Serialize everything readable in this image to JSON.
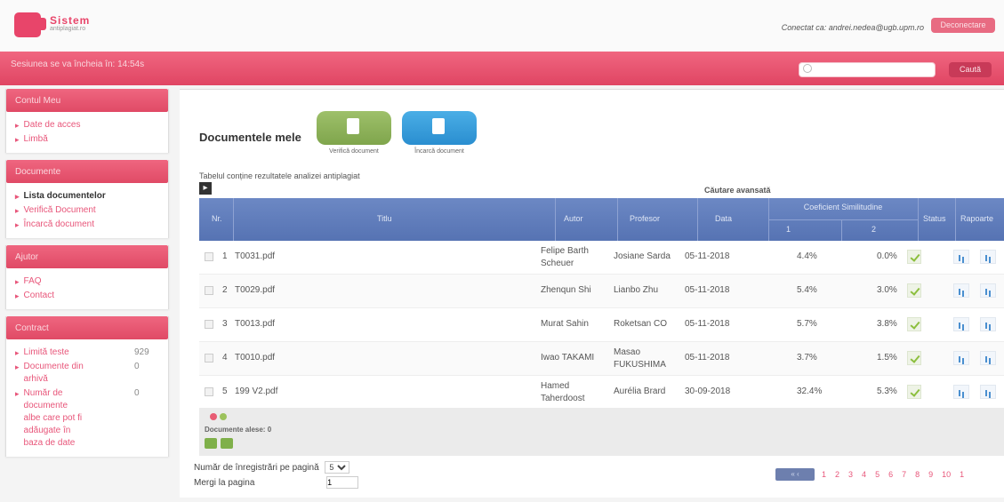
{
  "header": {
    "logo_line1": "Sistem",
    "logo_line2": "antiplagiat.ro",
    "connected_text": "Conectat ca: andrei.nedea@ugb.upm.ro",
    "logout_label": "Deconectare"
  },
  "sessionbar": {
    "session_text": "Sesiunea se va încheia în: 14:54s",
    "search_placeholder": "",
    "search_button": "Caută"
  },
  "sidebar": {
    "account": {
      "title": "Contul Meu",
      "items": [
        "Date de acces",
        "Limbă"
      ]
    },
    "documents": {
      "title": "Documente",
      "items": [
        "Lista documentelor",
        "Verifică Document",
        "Încarcă document"
      ]
    },
    "help": {
      "title": "Ajutor",
      "items": [
        "FAQ",
        "Contact"
      ]
    },
    "contract": {
      "title": "Contract",
      "stats": [
        {
          "label": "Limită teste",
          "value": "929"
        },
        {
          "label": "Documente din arhivă",
          "value": "0"
        },
        {
          "label": "Număr de documente albe care pot fi adăugate în baza de date",
          "value": "0"
        }
      ]
    }
  },
  "main": {
    "title": "Documentele mele",
    "verify_caption": "Verifică document",
    "upload_caption": "Încarcă document",
    "table_description": "Tabelul conține rezultatele analizei antiplagiat",
    "toggle_label": "▸",
    "advanced_search": "Căutare avansată",
    "columns": {
      "nr": "Nr.",
      "title": "Titlu",
      "author": "Autor",
      "professor": "Profesor",
      "date": "Data",
      "similarity": "Coeficient Similitudine",
      "coef1": "1",
      "coef2": "2",
      "status": "Status",
      "reports": "Rapoarte"
    },
    "rows": [
      {
        "nr": "1",
        "title": "T0031.pdf",
        "author": "Felipe Barth Scheuer",
        "professor": "Josiane Sarda",
        "date": "05-11-2018",
        "c1": "4.4%",
        "c2": "0.0%"
      },
      {
        "nr": "2",
        "title": "T0029.pdf",
        "author": "Zhenqun Shi",
        "professor": "Lianbo Zhu",
        "date": "05-11-2018",
        "c1": "5.4%",
        "c2": "3.0%"
      },
      {
        "nr": "3",
        "title": "T0013.pdf",
        "author": "Murat Sahin",
        "professor": "Roketsan CO",
        "date": "05-11-2018",
        "c1": "5.7%",
        "c2": "3.8%"
      },
      {
        "nr": "4",
        "title": "T0010.pdf",
        "author": "Iwao TAKAMI",
        "professor": "Masao FUKUSHIMA",
        "date": "05-11-2018",
        "c1": "3.7%",
        "c2": "1.5%"
      },
      {
        "nr": "5",
        "title": "199 V2.pdf",
        "author": "Hamed Taherdoost",
        "professor": "Aurélia Brard",
        "date": "30-09-2018",
        "c1": "32.4%",
        "c2": "5.3%"
      }
    ],
    "selected_docs": "Documente alese: 0",
    "per_page_label": "Număr de înregistrări pe pagină",
    "per_page_value": "5",
    "goto_label": "Mergi la pagina",
    "goto_value": "1",
    "pager_prev": "« ‹",
    "pages": [
      "1",
      "2",
      "3",
      "4",
      "5",
      "6",
      "7",
      "8",
      "9",
      "10",
      "1"
    ]
  }
}
